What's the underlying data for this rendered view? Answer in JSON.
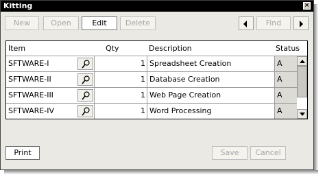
{
  "window": {
    "title": "Kitting",
    "close_label": "×"
  },
  "toolbar": {
    "new_label": "New",
    "open_label": "Open",
    "edit_label": "Edit",
    "delete_label": "Delete",
    "find_label": "Find"
  },
  "grid": {
    "columns": [
      "Item",
      "Qty",
      "Description",
      "Status"
    ],
    "rows": [
      {
        "item": "SFTWARE-I",
        "qty": "1",
        "description": "Spreadsheet Creation",
        "status": "A"
      },
      {
        "item": "SFTWARE-II",
        "qty": "1",
        "description": "Database Creation",
        "status": "A"
      },
      {
        "item": "SFTWARE-III",
        "qty": "1",
        "description": "Web Page Creation",
        "status": "A"
      },
      {
        "item": "SFTWARE-IV",
        "qty": "1",
        "description": "Word Processing",
        "status": "A"
      }
    ]
  },
  "footer": {
    "print_label": "Print",
    "save_label": "Save",
    "cancel_label": "Cancel"
  },
  "icons": {
    "lookup": "magnifier-icon",
    "prev": "left-arrow-icon",
    "next": "right-arrow-icon"
  }
}
